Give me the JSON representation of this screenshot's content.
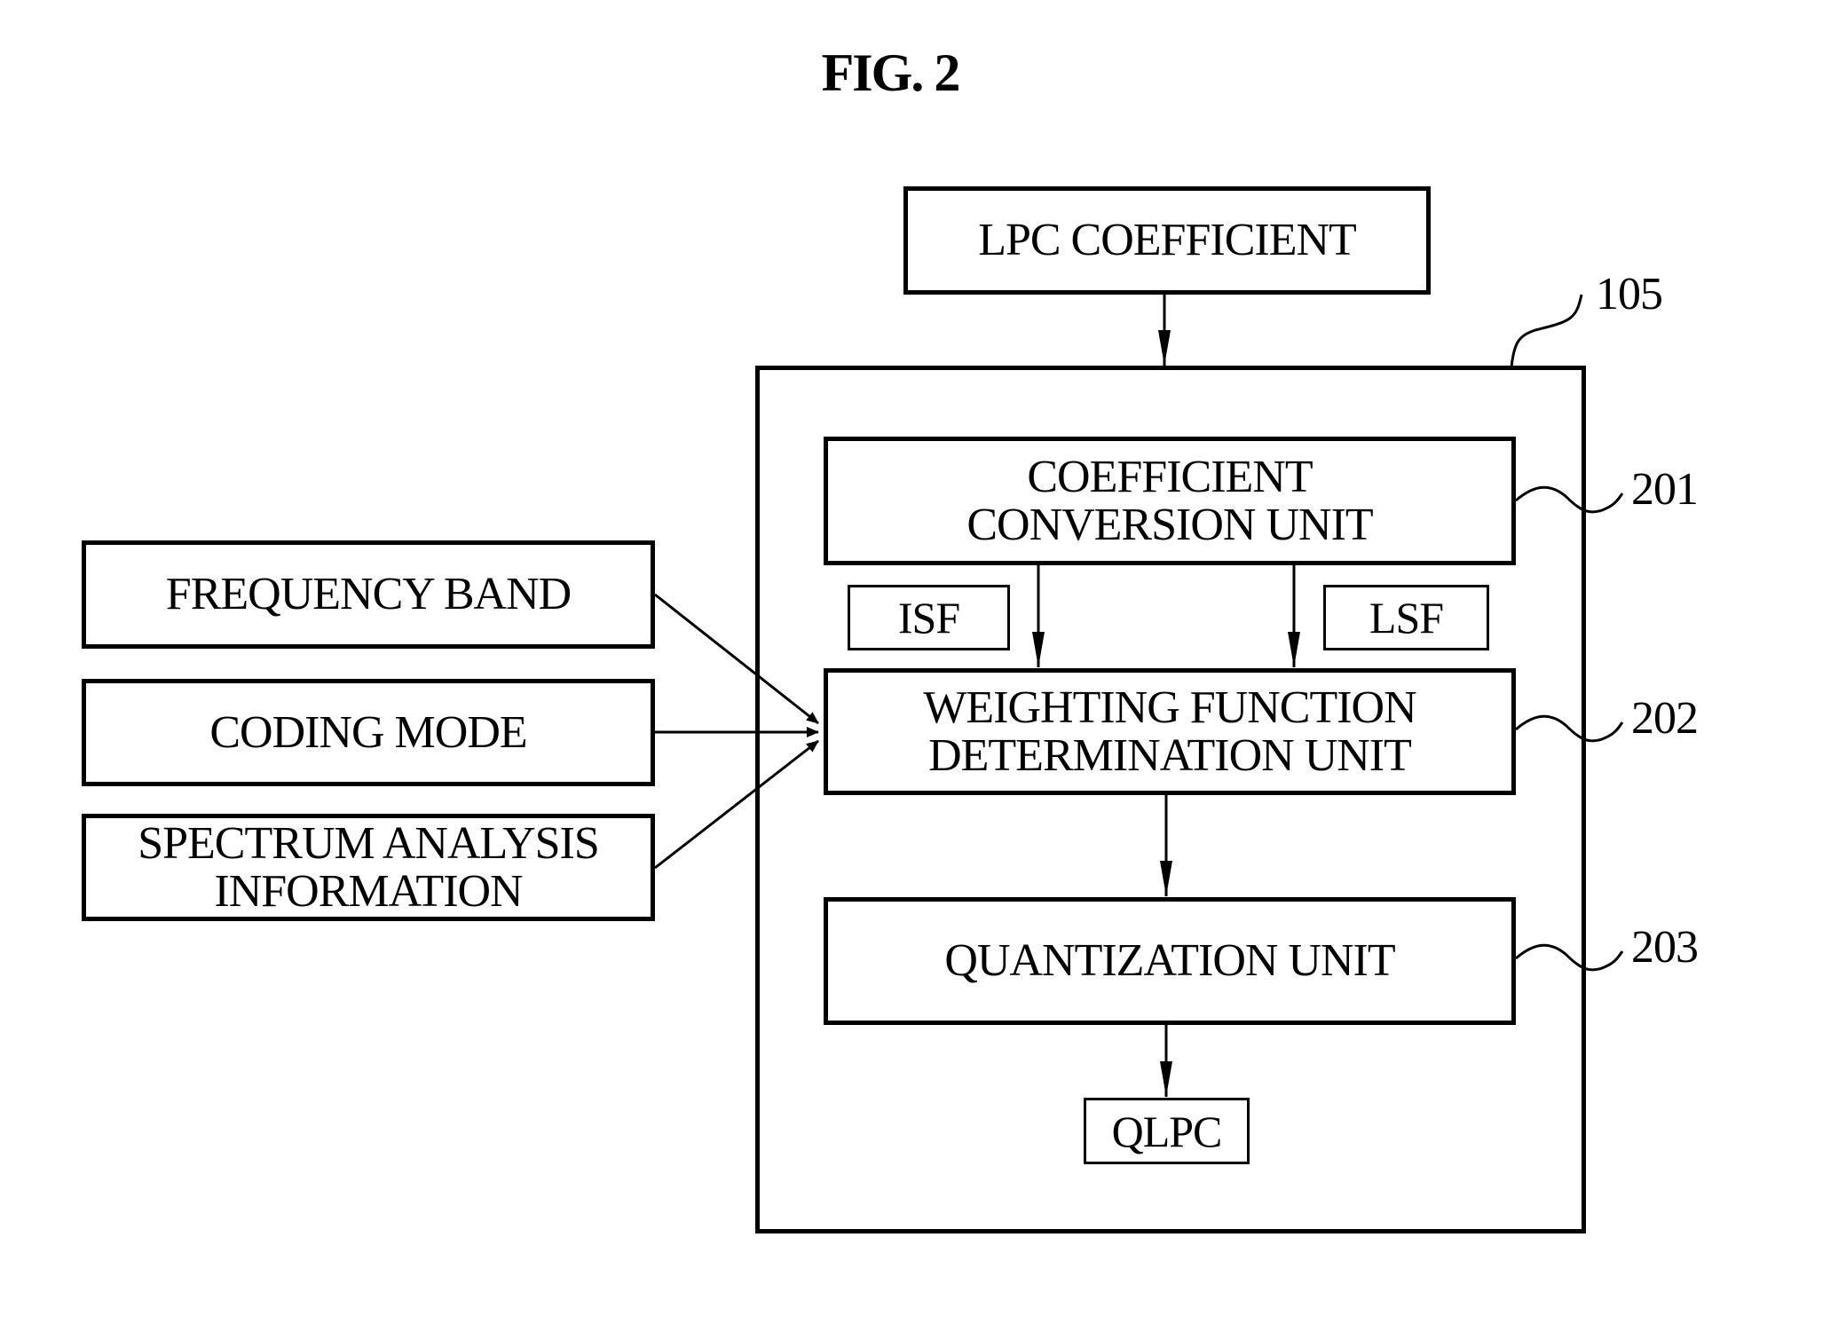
{
  "figure": {
    "title": "FIG. 2"
  },
  "blocks": {
    "lpc_coefficient": "LPC COEFFICIENT",
    "coefficient_conversion_unit": [
      "COEFFICIENT",
      "CONVERSION UNIT"
    ],
    "weighting_function_unit": [
      "WEIGHTING FUNCTION",
      "DETERMINATION UNIT"
    ],
    "quantization_unit": "QUANTIZATION UNIT",
    "qlpc": "QLPC",
    "isf": "ISF",
    "lsf": "LSF",
    "frequency_band": "FREQUENCY BAND",
    "coding_mode": "CODING MODE",
    "spectrum_analysis": [
      "SPECTRUM ANALYSIS",
      "INFORMATION"
    ]
  },
  "references": {
    "outer": "105",
    "conversion": "201",
    "weighting": "202",
    "quantization": "203"
  }
}
